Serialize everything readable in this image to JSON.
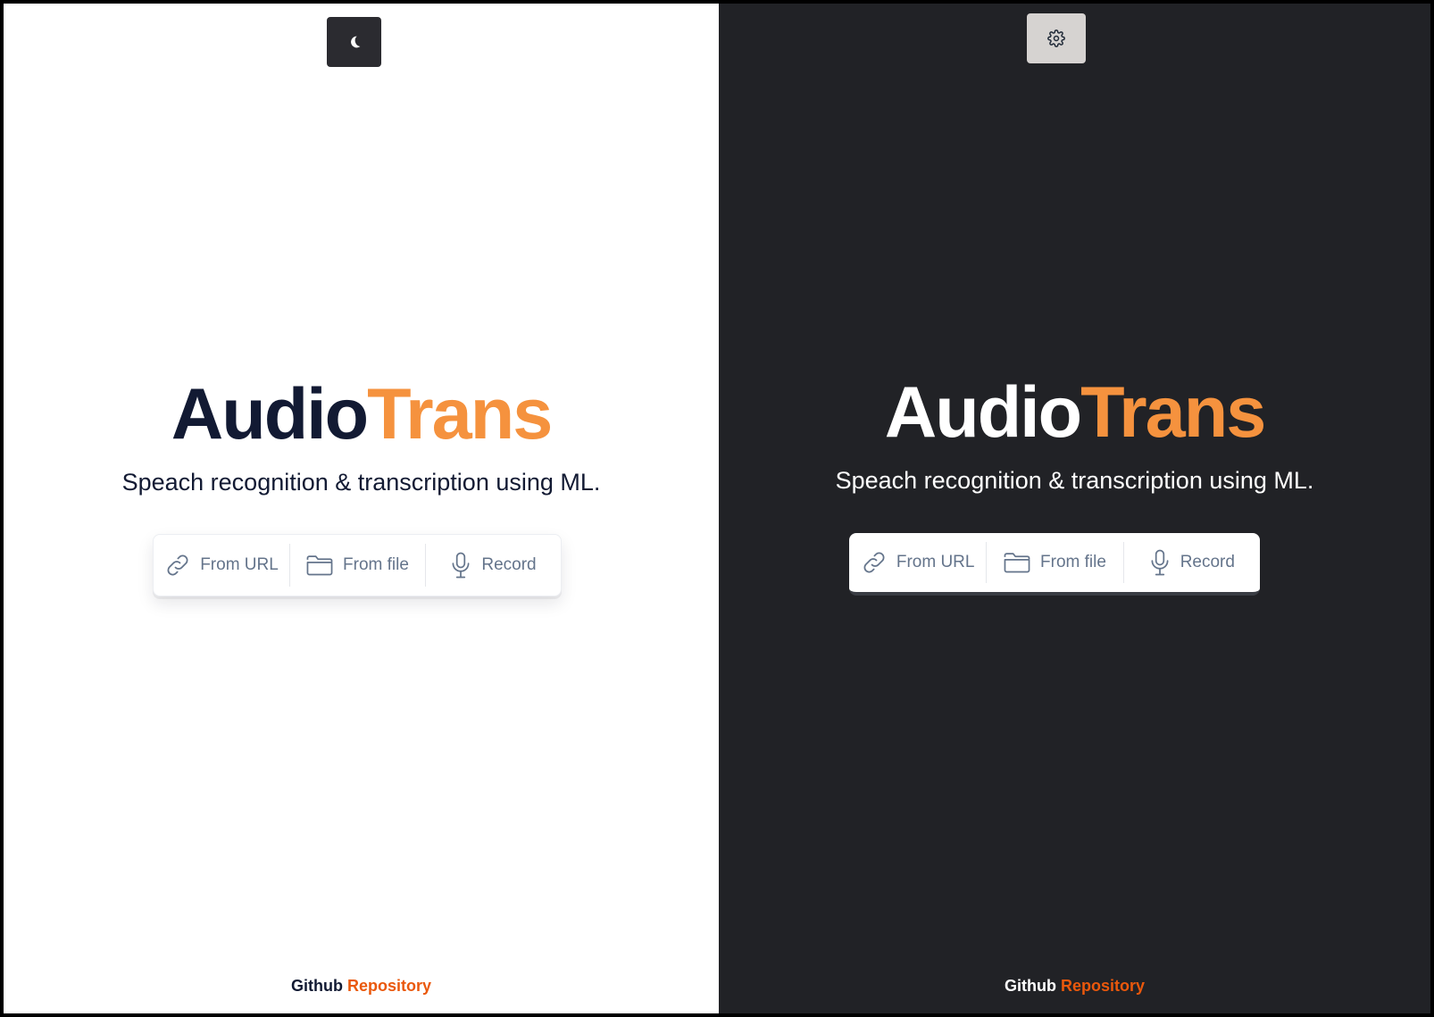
{
  "colors": {
    "accent": "#f5923e",
    "link": "#ea580c",
    "light_background": "#ffffff",
    "dark_background": "#212226",
    "light_title": "#121a33",
    "option_text": "#64748b"
  },
  "light": {
    "theme_toggle": {
      "icon": "moon-icon"
    },
    "title": {
      "part1": "Audio",
      "part2": "Trans"
    },
    "subtitle": "Speach recognition & transcription using ML.",
    "options": [
      {
        "label": "From URL",
        "icon": "link-icon"
      },
      {
        "label": "From file",
        "icon": "folder-icon"
      },
      {
        "label": "Record",
        "icon": "microphone-icon"
      }
    ],
    "footer": {
      "text": "Github",
      "link": "Repository"
    }
  },
  "dark": {
    "theme_toggle": {
      "icon": "gear-icon"
    },
    "title": {
      "part1": "Audio",
      "part2": "Trans"
    },
    "subtitle": "Speach recognition & transcription using ML.",
    "options": [
      {
        "label": "From URL",
        "icon": "link-icon"
      },
      {
        "label": "From file",
        "icon": "folder-icon"
      },
      {
        "label": "Record",
        "icon": "microphone-icon"
      }
    ],
    "footer": {
      "text": "Github",
      "link": "Repository"
    }
  }
}
